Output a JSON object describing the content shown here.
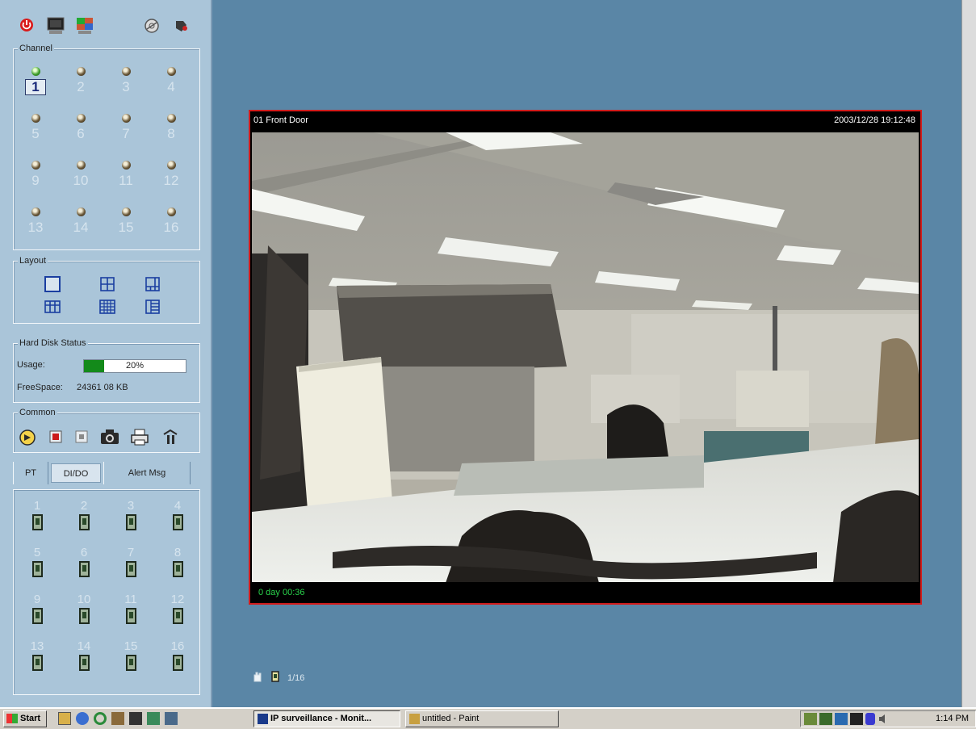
{
  "toolbar": {
    "icons": [
      "power-icon",
      "monitor-icon",
      "color-icon",
      "settings-disc-icon",
      "tools-icon"
    ]
  },
  "channel_group": {
    "title": "Channel",
    "channels": [
      "1",
      "2",
      "3",
      "4",
      "5",
      "6",
      "7",
      "8",
      "9",
      "10",
      "11",
      "12",
      "13",
      "14",
      "15",
      "16"
    ],
    "selected": "1",
    "active_channels": [
      "1"
    ]
  },
  "layout_group": {
    "title": "Layout",
    "options": [
      "single",
      "quad",
      "six",
      "nine",
      "thirteen",
      "sixteen"
    ]
  },
  "hard_disk": {
    "title": "Hard Disk Status",
    "usage_label": "Usage:",
    "usage_percent": 20,
    "usage_text": "20%",
    "free_label": "FreeSpace:",
    "free_value": "24361 08 KB"
  },
  "common_group": {
    "title": "Common",
    "icons": [
      "playback-icon",
      "record-icon",
      "stop-icon",
      "snapshot-icon",
      "print-icon",
      "exit-icon"
    ]
  },
  "tabs": [
    {
      "label": "PT",
      "active": false
    },
    {
      "label": "DI/DO",
      "active": true
    },
    {
      "label": "Alert Msg",
      "active": false
    }
  ],
  "dido_outputs": [
    "1",
    "2",
    "3",
    "4",
    "5",
    "6",
    "7",
    "8",
    "9",
    "10",
    "11",
    "12",
    "13",
    "14",
    "15",
    "16"
  ],
  "video": {
    "channel_label": "01 Front Door",
    "timestamp": "2003/12/28 19:12:48",
    "status_text": "0 day 00:36"
  },
  "page_indicator": "1/16",
  "taskbar": {
    "start_label": "Start",
    "tasks": [
      {
        "label": "IP surveillance - Monit...",
        "pressed": true
      },
      {
        "label": "untitled - Paint",
        "pressed": false
      }
    ],
    "clock": "1:14 PM"
  },
  "colors": {
    "panel_bg": "#aac5d9",
    "desktop_bg": "#5a86a6",
    "video_border": "#d21c1c",
    "status_text": "#29d24b",
    "usage_fill": "#138a1a"
  }
}
